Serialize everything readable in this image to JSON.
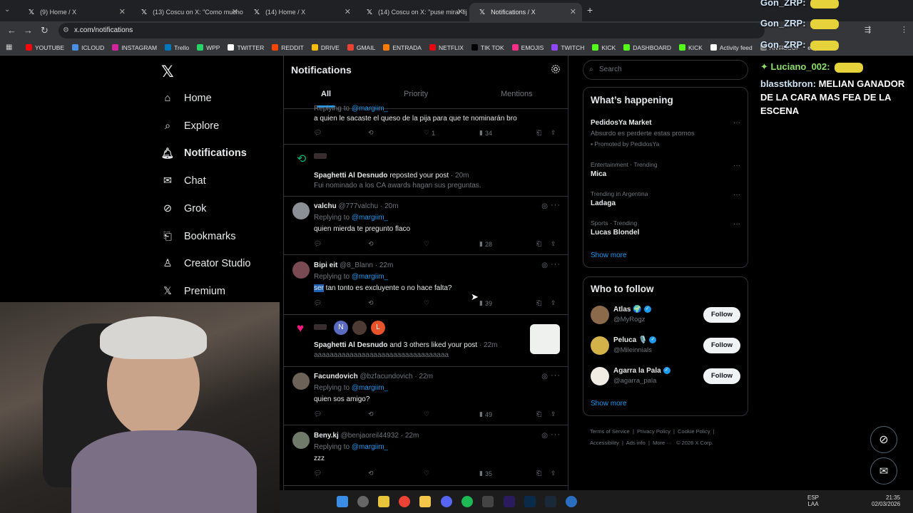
{
  "browser": {
    "tabs": [
      {
        "label": "(9) Home / X",
        "active": false
      },
      {
        "label": "(13) Coscu on X: \"Como mucho",
        "active": false
      },
      {
        "label": "(14) Home / X",
        "active": false
      },
      {
        "label": "(14) Coscu on X: \"puse mirar fij",
        "active": false
      },
      {
        "label": "Notifications / X",
        "active": true
      }
    ],
    "url": "x.com/notifications",
    "bookmarks": [
      {
        "label": "YOUTUBE",
        "color": "#ff0000"
      },
      {
        "label": "ICLOUD",
        "color": "#4a90e2"
      },
      {
        "label": "INSTAGRAM",
        "color": "#d6249f"
      },
      {
        "label": "Trello",
        "color": "#0079bf"
      },
      {
        "label": "WPP",
        "color": "#25d366"
      },
      {
        "label": "TWITTER",
        "color": "#ffffff"
      },
      {
        "label": "REDDIT",
        "color": "#ff4500"
      },
      {
        "label": "DRIVE",
        "color": "#fbbc04"
      },
      {
        "label": "GMAIL",
        "color": "#ea4335"
      },
      {
        "label": "ENTRADA",
        "color": "#ff7a00"
      },
      {
        "label": "NETFLIX",
        "color": "#e50914"
      },
      {
        "label": "TIK TOK",
        "color": "#000000"
      },
      {
        "label": "EMOJIS",
        "color": "#ff2d85"
      },
      {
        "label": "TWITCH",
        "color": "#9146ff"
      },
      {
        "label": "KICK",
        "color": "#53fc18"
      },
      {
        "label": "DASHBOARD",
        "color": "#53fc18"
      },
      {
        "label": "KICK",
        "color": "#53fc18"
      },
      {
        "label": "Activity feed",
        "color": "#ffffff"
      },
      {
        "label": "ANTISCUF",
        "color": "#888888"
      }
    ],
    "bookmark_overflow": "er | Resi..."
  },
  "sidebar": {
    "items": [
      {
        "label": "Home",
        "icon": "home-icon"
      },
      {
        "label": "Explore",
        "icon": "search-icon"
      },
      {
        "label": "Notifications",
        "icon": "bell-icon",
        "active": true
      },
      {
        "label": "Chat",
        "icon": "mail-icon"
      },
      {
        "label": "Grok",
        "icon": "grok-icon"
      },
      {
        "label": "Bookmarks",
        "icon": "bookmark-icon"
      },
      {
        "label": "Creator Studio",
        "icon": "creator-icon"
      },
      {
        "label": "Premium",
        "icon": "x-icon"
      }
    ]
  },
  "main": {
    "title": "Notifications",
    "tabs": [
      "All",
      "Priority",
      "Mentions"
    ],
    "posts": [
      {
        "reply_label": "Replying to",
        "mention": "@margiim_",
        "text": "a quien le sacaste el queso de la pija para que te nominarán bro",
        "likes": "1",
        "views": "34"
      },
      {
        "actor": "Spaghetti Al Desnudo",
        "action": "reposted your post",
        "time": "· 20m",
        "snippet": "Fui nominado a los CA awards hagan sus preguntas."
      },
      {
        "name": "valchu",
        "handle": "@777valchu",
        "time": "· 20m",
        "reply_label": "Replying to",
        "mention": "@margiim_",
        "text": "quien mierda te pregunto flaco",
        "views": "28"
      },
      {
        "name": "Bipi eit",
        "handle": "@8_Blann",
        "time": "· 22m",
        "reply_label": "Replying to",
        "mention": "@margiim_",
        "text_highlight": "ser",
        "text": " tan tonto es excluyente o no hace falta?",
        "views": "39"
      },
      {
        "actor": "Spaghetti Al Desnudo",
        "action": "and 3 others liked your post",
        "time": "· 22m",
        "snippet": "aaaaaaaaaaaaaaaaaaaaaaaaaaaaaaaaaa",
        "avatars": [
          "N",
          "L"
        ]
      },
      {
        "name": "Facundovich",
        "handle": "@bzfacundovich",
        "time": "· 22m",
        "reply_label": "Replying to",
        "mention": "@margiim_",
        "text": "quien sos amigo?",
        "views": "49"
      },
      {
        "name": "Beny.kj",
        "handle": "@benjaoreil44932",
        "time": "· 22m",
        "reply_label": "Replying to",
        "mention": "@margiim_",
        "text": "zzz",
        "views": "35"
      }
    ]
  },
  "right": {
    "search_placeholder": "Search",
    "happening": {
      "title": "What’s happening",
      "promo": {
        "name": "PedidosYa Market",
        "text": "Absurdo es perderte estas promos",
        "promoted": "Promoted by PedidosYa"
      },
      "trends": [
        {
          "meta": "Entertainment · Trending",
          "name": "Mica"
        },
        {
          "meta": "Trending in Argentina",
          "name": "Ladaga"
        },
        {
          "meta": "Sports · Trending",
          "name": "Lucas Blondel"
        }
      ],
      "show_more": "Show more"
    },
    "who_to_follow": {
      "title": "Who to follow",
      "users": [
        {
          "name": "Atlas 🌍",
          "handle": "@MyRogz",
          "button": "Follow"
        },
        {
          "name": "Peluca 🎙️",
          "handle": "@Mileinnials",
          "button": "Follow"
        },
        {
          "name": "Agarra la Pala",
          "handle": "@agarra_pala",
          "button": "Follow"
        }
      ],
      "show_more": "Show more"
    },
    "footer": [
      "Terms of Service",
      "Privacy Policy",
      "Cookie Policy",
      "Accessibility",
      "Ads info",
      "More ···",
      "© 2026 X Corp."
    ]
  },
  "stream_chat": {
    "lines": [
      {
        "user": "Gon_ZRP:",
        "msg": ""
      },
      {
        "user": "Gon_ZRP:",
        "msg": ""
      },
      {
        "user": "Gon_ZRP:",
        "msg": ""
      },
      {
        "user": "Luciano_002:",
        "msg": ""
      },
      {
        "user": "blasstkbron:",
        "msg": "MELIAN GANADOR DE LA CARA MAS FEA DE LA ESCENA"
      }
    ]
  },
  "taskbar": {
    "lang": "ESP",
    "lang_sub": "LAA",
    "time": "21:35",
    "date": "02/03/2026"
  },
  "colors": {
    "accent": "#1d9bf0",
    "retweet": "#00ba7c",
    "like": "#f91880"
  }
}
